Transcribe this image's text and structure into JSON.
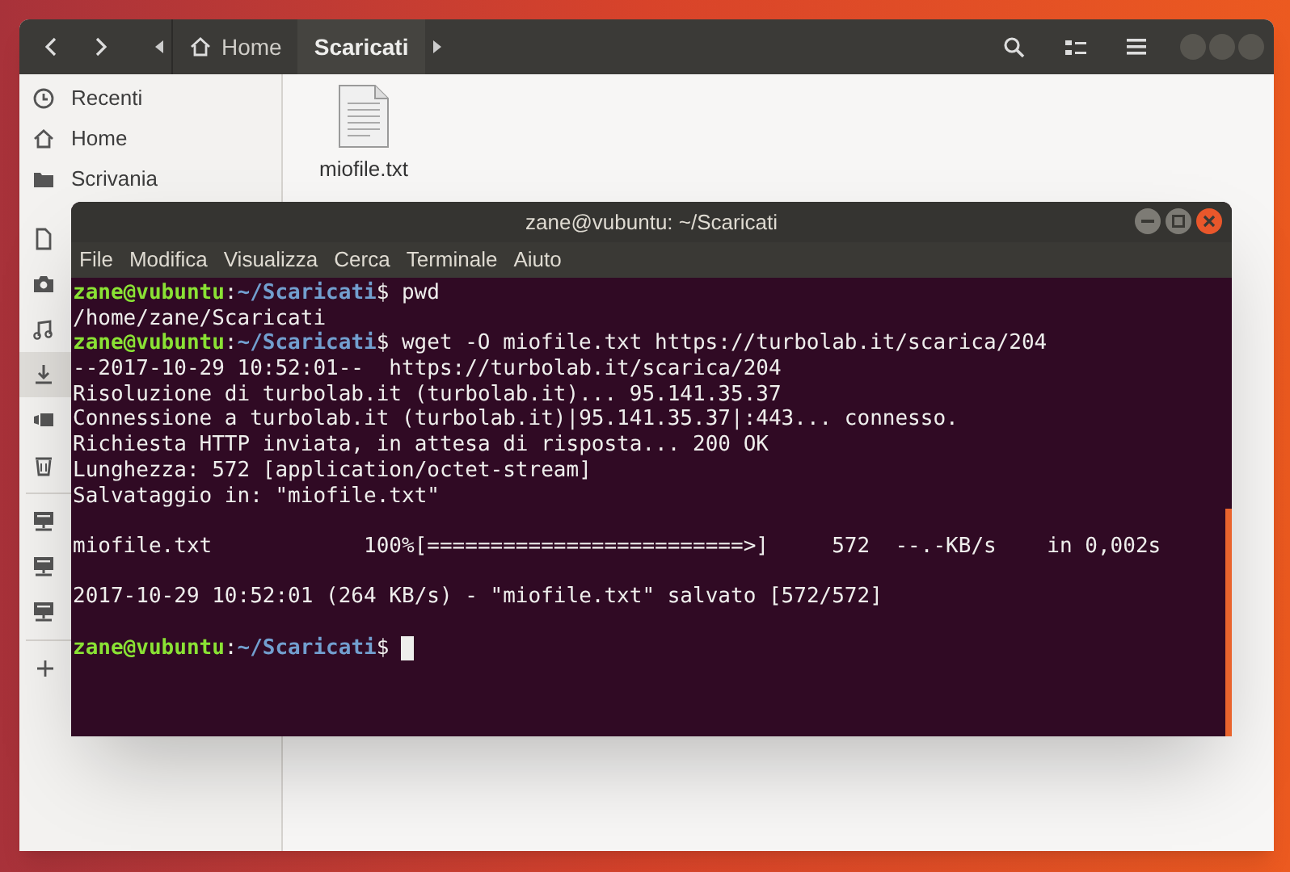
{
  "file_manager": {
    "path_bar": [
      {
        "label": "Home",
        "kind": "home",
        "selected": false
      },
      {
        "label": "Scaricati",
        "kind": "folder",
        "selected": true
      }
    ],
    "sidebar": {
      "places": [
        {
          "label": "Recenti",
          "kind": "recent",
          "selected": false
        },
        {
          "label": "Home",
          "kind": "home",
          "selected": false
        },
        {
          "label": "Scrivania",
          "kind": "desktop",
          "selected": false
        },
        {
          "kind": "documents",
          "selected": false
        },
        {
          "kind": "pictures",
          "selected": false
        },
        {
          "kind": "music",
          "selected": false
        },
        {
          "kind": "downloads",
          "selected": true
        },
        {
          "kind": "videos",
          "selected": false
        },
        {
          "kind": "trash",
          "selected": false
        }
      ],
      "devices": [
        {
          "kind": "drive",
          "selected": false
        },
        {
          "kind": "drive",
          "selected": false
        },
        {
          "kind": "drive",
          "selected": false
        }
      ]
    },
    "files": [
      {
        "name": "miofile.txt",
        "kind": "text"
      }
    ]
  },
  "terminal": {
    "title": "zane@vubuntu: ~/Scaricati",
    "menu": [
      "File",
      "Modifica",
      "Visualizza",
      "Cerca",
      "Terminale",
      "Aiuto"
    ],
    "lines": [
      {
        "kind": "prompt",
        "user": "zane@vubuntu",
        "separator": ":",
        "path": "~/Scaricati",
        "symbol": "$",
        "command": "pwd"
      },
      {
        "kind": "output",
        "text": "/home/zane/Scaricati"
      },
      {
        "kind": "prompt",
        "user": "zane@vubuntu",
        "separator": ":",
        "path": "~/Scaricati",
        "symbol": "$",
        "command": "wget -O miofile.txt https://turbolab.it/scarica/204"
      },
      {
        "kind": "output",
        "text": "--2017-10-29 10:52:01--  https://turbolab.it/scarica/204"
      },
      {
        "kind": "output",
        "text": "Risoluzione di turbolab.it (turbolab.it)... 95.141.35.37"
      },
      {
        "kind": "output",
        "text": "Connessione a turbolab.it (turbolab.it)|95.141.35.37|:443... connesso."
      },
      {
        "kind": "output",
        "text": "Richiesta HTTP inviata, in attesa di risposta... 200 OK"
      },
      {
        "kind": "output",
        "text": "Lunghezza: 572 [application/octet-stream]"
      },
      {
        "kind": "output",
        "text": "Salvataggio in: \"miofile.txt\""
      },
      {
        "kind": "blank"
      },
      {
        "kind": "output",
        "text": "miofile.txt            100%[=========================>]     572  --.-KB/s    in 0,002s"
      },
      {
        "kind": "blank"
      },
      {
        "kind": "output",
        "text": "2017-10-29 10:52:01 (264 KB/s) - \"miofile.txt\" salvato [572/572]"
      },
      {
        "kind": "blank"
      },
      {
        "kind": "prompt",
        "user": "zane@vubuntu",
        "separator": ":",
        "path": "~/Scaricati",
        "symbol": "$",
        "cursor": true
      }
    ]
  }
}
